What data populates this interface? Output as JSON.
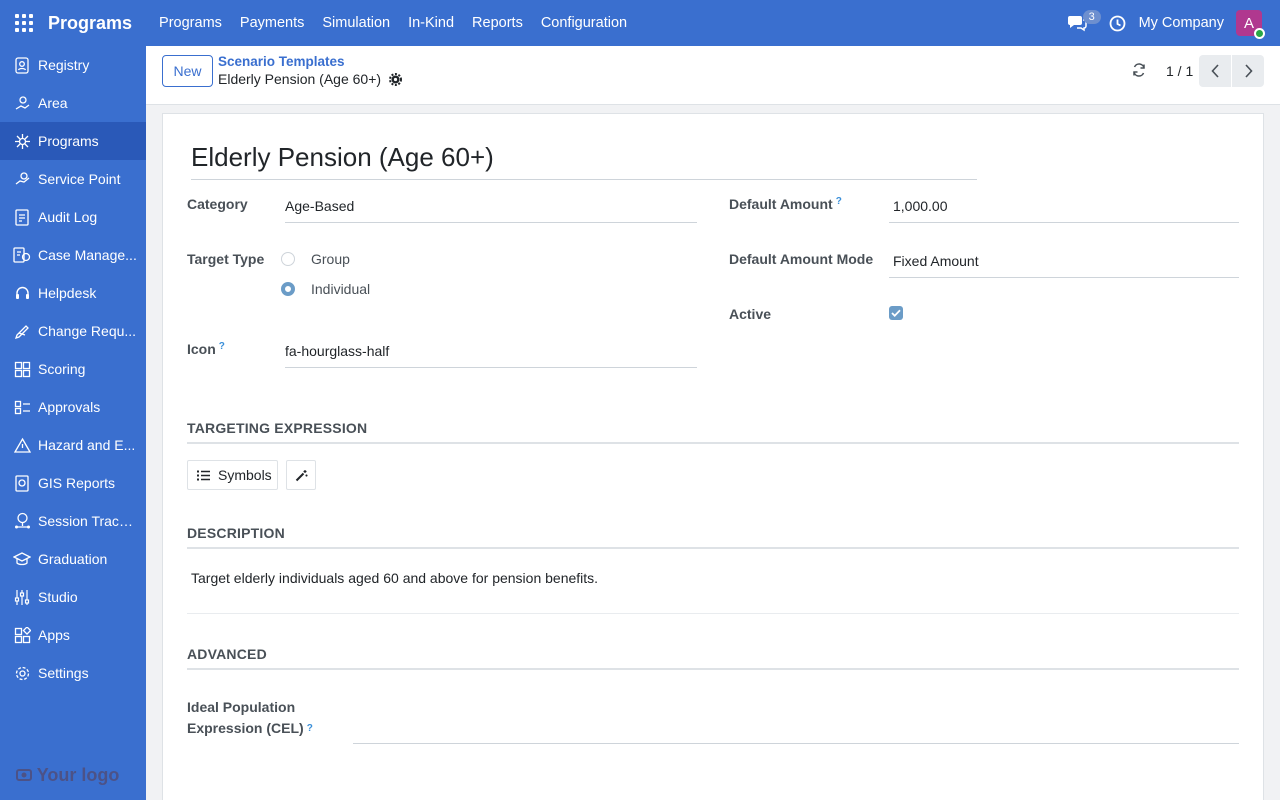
{
  "app": {
    "brand": "Programs",
    "menu": [
      "Programs",
      "Payments",
      "Simulation",
      "In-Kind",
      "Reports",
      "Configuration"
    ],
    "messages_count": "3",
    "company": "My Company",
    "avatar_letter": "A"
  },
  "sidebar": {
    "items": [
      {
        "label": "Registry",
        "icon": "registry-icon"
      },
      {
        "label": "Area",
        "icon": "area-icon"
      },
      {
        "label": "Programs",
        "icon": "programs-icon",
        "active": true
      },
      {
        "label": "Service Point",
        "icon": "service-point-icon"
      },
      {
        "label": "Audit Log",
        "icon": "audit-log-icon"
      },
      {
        "label": "Case Manage...",
        "icon": "case-management-icon"
      },
      {
        "label": "Helpdesk",
        "icon": "headset-icon"
      },
      {
        "label": "Change Requ...",
        "icon": "change-request-icon"
      },
      {
        "label": "Scoring",
        "icon": "scoring-icon"
      },
      {
        "label": "Approvals",
        "icon": "approvals-icon"
      },
      {
        "label": "Hazard and E...",
        "icon": "hazard-icon"
      },
      {
        "label": "GIS Reports",
        "icon": "gis-reports-icon"
      },
      {
        "label": "Session Tracki...",
        "icon": "session-tracking-icon"
      },
      {
        "label": "Graduation",
        "icon": "graduation-cap-icon"
      },
      {
        "label": "Studio",
        "icon": "studio-sliders-icon"
      },
      {
        "label": "Apps",
        "icon": "apps-icon"
      },
      {
        "label": "Settings",
        "icon": "gear-icon"
      }
    ],
    "logo": "Your logo"
  },
  "control": {
    "new_label": "New",
    "breadcrumb_parent": "Scenario Templates",
    "breadcrumb_current": "Elderly Pension (Age 60+)",
    "pager": "1 / 1"
  },
  "form": {
    "title": "Elderly Pension (Age 60+)",
    "category_label": "Category",
    "category_value": "Age-Based",
    "target_type_label": "Target Type",
    "target_options": [
      "Group",
      "Individual"
    ],
    "target_selected": "Individual",
    "icon_label": "Icon",
    "icon_value": "fa-hourglass-half",
    "default_amount_label": "Default Amount",
    "default_amount_value": "1,000.00",
    "default_amount_mode_label": "Default Amount Mode",
    "default_amount_mode_value": "Fixed Amount",
    "active_label": "Active",
    "active": true,
    "help_mark": "?",
    "targeting_section": "TARGETING EXPRESSION",
    "symbols_label": "Symbols",
    "description_section": "DESCRIPTION",
    "description_text": "Target elderly individuals aged 60 and above for pension benefits.",
    "advanced_section": "ADVANCED",
    "ideal_population_label": "Ideal Population Expression (CEL)"
  },
  "colors": {
    "primary": "#3a6fcf",
    "sidebar_active": "#2a59b8",
    "avatar": "#b0388f",
    "checkbox": "#6b9cc7"
  }
}
